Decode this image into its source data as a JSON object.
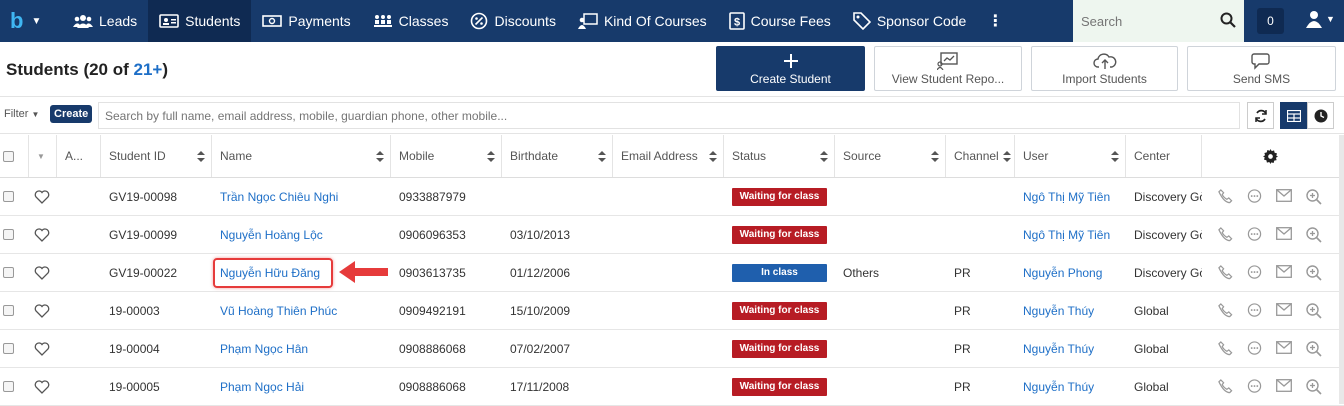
{
  "nav": {
    "brand": "b",
    "items": [
      {
        "label": "Leads",
        "icon": "users-icon"
      },
      {
        "label": "Students",
        "icon": "id-card-icon"
      },
      {
        "label": "Payments",
        "icon": "money-icon"
      },
      {
        "label": "Classes",
        "icon": "classes-icon"
      },
      {
        "label": "Discounts",
        "icon": "percent-icon"
      },
      {
        "label": "Kind Of Courses",
        "icon": "course-icon"
      },
      {
        "label": "Course Fees",
        "icon": "dollar-icon"
      },
      {
        "label": "Sponsor Code",
        "icon": "tag-icon"
      }
    ],
    "search_placeholder": "Search",
    "notification_count": "0"
  },
  "header": {
    "title_prefix": "Students (20 of ",
    "title_total": "21+",
    "title_suffix": ")",
    "actions": {
      "create": "Create Student",
      "report": "View Student Repo...",
      "import": "Import Students",
      "sms": "Send SMS"
    }
  },
  "filter": {
    "filter_label": "Filter",
    "create_label": "Create",
    "placeholder": "Search by full name, email address, mobile, guardian phone, other mobile..."
  },
  "table": {
    "columns": {
      "avatar": "A...",
      "student_id": "Student ID",
      "name": "Name",
      "mobile": "Mobile",
      "birthdate": "Birthdate",
      "email": "Email Address",
      "status": "Status",
      "source": "Source",
      "channel": "Channel",
      "user": "User",
      "center": "Center"
    },
    "rows": [
      {
        "id": "GV19-00098",
        "name": "Trần Ngọc Chiêu Nghi",
        "mobile": "0933887979",
        "birthdate": "",
        "email": "",
        "status": "Waiting for class",
        "source": "",
        "channel": "",
        "user": "Ngô Thị Mỹ Tiên",
        "center": "Discovery Gò Vấp"
      },
      {
        "id": "GV19-00099",
        "name": "Nguyễn Hoàng Lộc",
        "mobile": "0906096353",
        "birthdate": "03/10/2013",
        "email": "",
        "status": "Waiting for class",
        "source": "",
        "channel": "",
        "user": "Ngô Thị Mỹ Tiên",
        "center": "Discovery Gò Vấp"
      },
      {
        "id": "GV19-00022",
        "name": "Nguyễn Hữu Đăng",
        "mobile": "0903613735",
        "birthdate": "01/12/2006",
        "email": "",
        "status": "In class",
        "source": "Others",
        "channel": "PR",
        "user": "Nguyễn Phong",
        "center": "Discovery Gò Vấp"
      },
      {
        "id": "19-00003",
        "name": "Vũ Hoàng Thiên Phúc",
        "mobile": "0909492191",
        "birthdate": "15/10/2009",
        "email": "",
        "status": "Waiting for class",
        "source": "",
        "channel": "PR",
        "user": "Nguyễn Thúy",
        "center": "Global"
      },
      {
        "id": "19-00004",
        "name": "Phạm Ngọc Hân",
        "mobile": "0908886068",
        "birthdate": "07/02/2007",
        "email": "",
        "status": "Waiting for class",
        "source": "",
        "channel": "PR",
        "user": "Nguyễn Thúy",
        "center": "Global"
      },
      {
        "id": "19-00005",
        "name": "Phạm Ngọc Hải",
        "mobile": "0908886068",
        "birthdate": "17/11/2008",
        "email": "",
        "status": "Waiting for class",
        "source": "",
        "channel": "PR",
        "user": "Nguyễn Thúy",
        "center": "Global"
      }
    ]
  },
  "colors": {
    "nav_bg": "#173a6b",
    "accent": "#1e6fc7",
    "waiting": "#b71c24",
    "in_class": "#1f5fad",
    "highlight": "#e63b3b"
  }
}
